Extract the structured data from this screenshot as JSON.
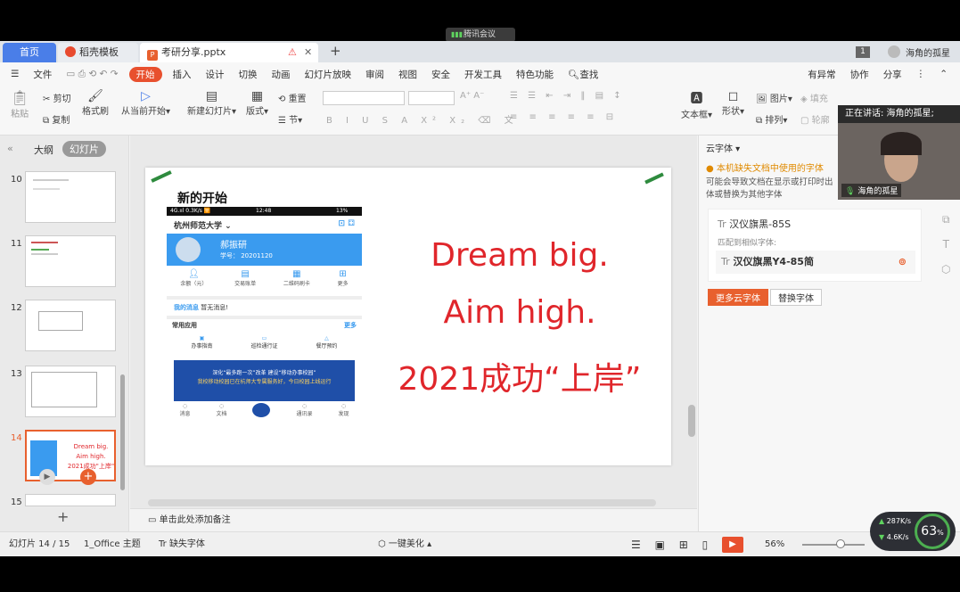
{
  "meeting": {
    "title": "腾讯会议",
    "speaker_banner": "正在讲话: 海角的孤星;",
    "participant_name": "海角的孤星"
  },
  "tabs": [
    {
      "label": "首页"
    },
    {
      "label": "稻壳模板"
    },
    {
      "label": "考研分享.pptx"
    }
  ],
  "user": {
    "name": "海角的孤星",
    "badge": "1"
  },
  "menu": {
    "file": "文件",
    "items": [
      "开始",
      "插入",
      "设计",
      "切换",
      "动画",
      "幻灯片放映",
      "审阅",
      "视图",
      "安全",
      "开发工具",
      "特色功能",
      "查找"
    ],
    "right": [
      "有异常",
      "协作",
      "分享"
    ]
  },
  "ribbon": {
    "paste": "粘贴",
    "cut": "剪切",
    "copy": "复制",
    "format_painter": "格式刷",
    "from_current": "从当前开始",
    "new_slide": "新建幻灯片",
    "layout": "版式",
    "reset": "重置",
    "section": "节",
    "textbox": "文本框",
    "shape": "形状",
    "picture": "图片",
    "fill": "填充",
    "arrange": "排列",
    "outline": "轮廓"
  },
  "sidebar": {
    "tab_outline": "大纲",
    "tab_slides": "幻灯片",
    "slide_numbers": [
      "10",
      "11",
      "12",
      "13",
      "14",
      "15"
    ],
    "thumb14_lines": [
      "Dream big.",
      "Aim high.",
      "2021成功\"上岸\""
    ]
  },
  "slide": {
    "title": "新的开始",
    "lines": [
      "Dream big.",
      "Aim high.",
      "2021成功“上岸”"
    ],
    "phone": {
      "status_left": "4G.ııl 0.3K/s 🛜",
      "status_time": "12:48",
      "status_right": "13%",
      "school": "杭州师范大学",
      "user_name": "郝振研",
      "student_no": "学号： 20201120",
      "icons": [
        "余额（元）",
        "交易账单",
        "二维码刷卡",
        "更多"
      ],
      "news": "暂无消息!",
      "news_tag": "我的消息",
      "section": "常用应用",
      "more": "更多",
      "apps": [
        "办事指南",
        "巡检通行证",
        "餐厅预约"
      ],
      "banner1": "深化“最多跑一次”改革  建设“移动办事校园”",
      "banner2": "我校移动校园已在杭师大专属服务好，今日校园上线运行",
      "nav": [
        "消息",
        "文档",
        "",
        "通讯录",
        "发现"
      ]
    }
  },
  "notes_placeholder": "单击此处添加备注",
  "rightpanel": {
    "header": "云字体",
    "warning": "本机缺失文档中使用的字体",
    "desc1": "可能会导致文档在显示或打印时出",
    "desc2": "体或替换为其他字体",
    "font_name": "汉仪旗黑-85S",
    "match_label": "匹配到相似字体:",
    "match_font": "汉仪旗黑Y4-85简",
    "btn_more": "更多云字体",
    "btn_replace": "替换字体"
  },
  "status": {
    "slide_pos": "幻灯片 14 / 15",
    "theme": "1_Office 主题",
    "missing_font": "缺失字体",
    "beautify": "一键美化",
    "zoom": "56%"
  },
  "network": {
    "up": "287K/s",
    "down": "4.6K/s",
    "percent": "63",
    "unit": "%"
  },
  "colors": {
    "accent": "#e8502e",
    "tab_blue": "#4a7ee8",
    "slide_red": "#e0262b",
    "phone_blue": "#3a9bef"
  }
}
